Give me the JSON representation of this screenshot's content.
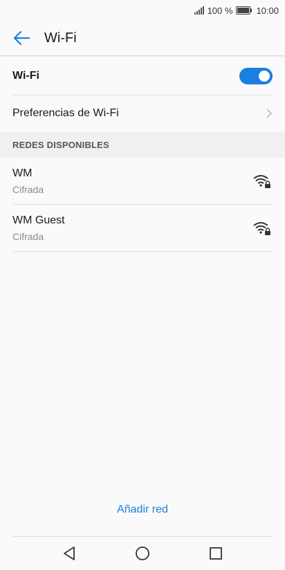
{
  "status_bar": {
    "battery_percent": "100 %",
    "time": "10:00",
    "icons": [
      "signal-icon",
      "battery-icon"
    ]
  },
  "app_bar": {
    "title": "Wi-Fi",
    "back_icon": "arrow-left-icon"
  },
  "wifi_toggle": {
    "label": "Wi-Fi",
    "enabled": true
  },
  "preferences": {
    "label": "Preferencias de Wi-Fi"
  },
  "available_networks": {
    "header": "REDES DISPONIBLES",
    "items": [
      {
        "name": "WM",
        "status": "Cifrada",
        "icon": "wifi-lock-icon"
      },
      {
        "name": "WM Guest",
        "status": "Cifrada",
        "icon": "wifi-lock-icon"
      }
    ]
  },
  "actions": {
    "add_network": "Añadir red"
  },
  "nav_bar": {
    "buttons": [
      "back-triangle-icon",
      "home-circle-icon",
      "recents-square-icon"
    ]
  },
  "colors": {
    "accent": "#1a7fe0",
    "background": "#fafafa",
    "section_bg": "#f0f0f0"
  }
}
